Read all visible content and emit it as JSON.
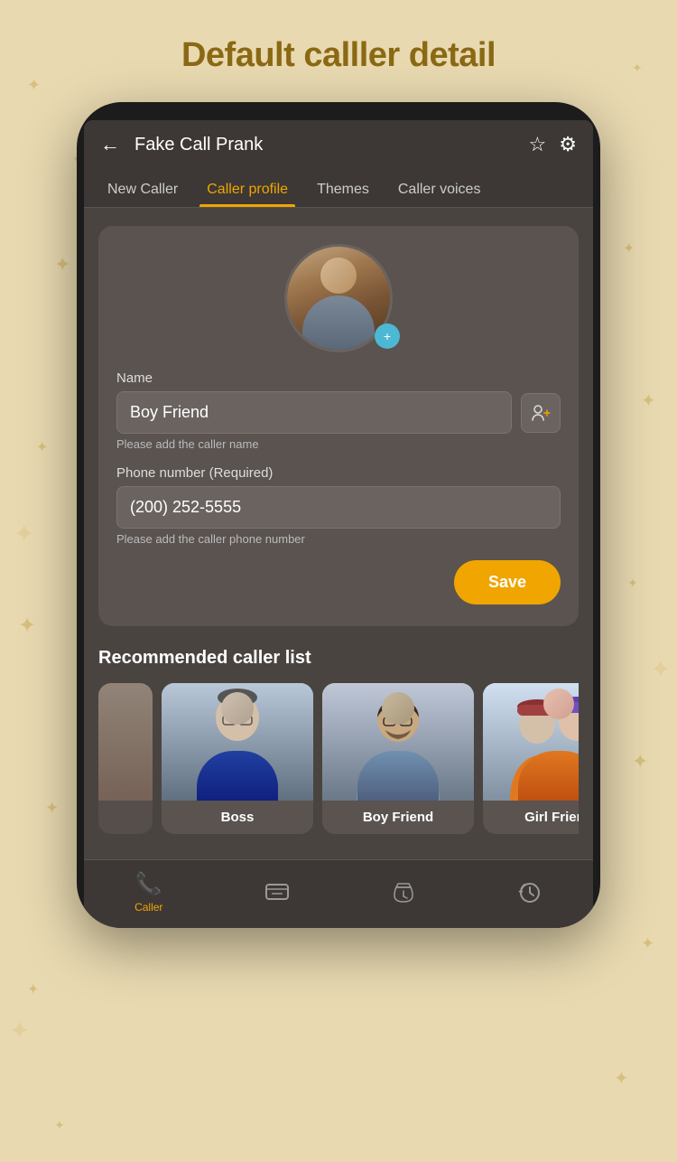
{
  "page": {
    "title": "Default calller detail",
    "background_color": "#e8d9b0",
    "accent_color": "#f0a500"
  },
  "app": {
    "name": "Fake Call Prank",
    "back_label": "←"
  },
  "header": {
    "title": "Fake Call Prank",
    "star_icon": "☆",
    "settings_icon": "⚙"
  },
  "tabs": [
    {
      "id": "new-caller",
      "label": "New Caller",
      "active": false
    },
    {
      "id": "caller-profile",
      "label": "Caller profile",
      "active": true
    },
    {
      "id": "themes",
      "label": "Themes",
      "active": false
    },
    {
      "id": "caller-voices",
      "label": "Caller voices",
      "active": false
    }
  ],
  "form": {
    "name_label": "Name",
    "name_value": "Boy Friend",
    "name_placeholder": "Boy Friend",
    "name_hint": "Please add the caller name",
    "phone_label": "Phone number (Required)",
    "phone_value": "(200) 252-5555",
    "phone_placeholder": "(200) 252-5555",
    "phone_hint": "Please add the caller phone number",
    "save_label": "Save"
  },
  "recommended": {
    "section_title": "Recommended caller list",
    "callers": [
      {
        "id": "boss",
        "name": "Boss"
      },
      {
        "id": "boyfriend",
        "name": "Boy Friend"
      },
      {
        "id": "girlfriend",
        "name": "Girl Friend"
      }
    ]
  },
  "bottom_nav": [
    {
      "id": "caller",
      "icon": "📞",
      "label": "Caller",
      "active": true
    },
    {
      "id": "messages",
      "icon": "💬",
      "label": "",
      "active": false
    },
    {
      "id": "timer",
      "icon": "⏳",
      "label": "",
      "active": false
    },
    {
      "id": "history",
      "icon": "🕐",
      "label": "",
      "active": false
    }
  ]
}
